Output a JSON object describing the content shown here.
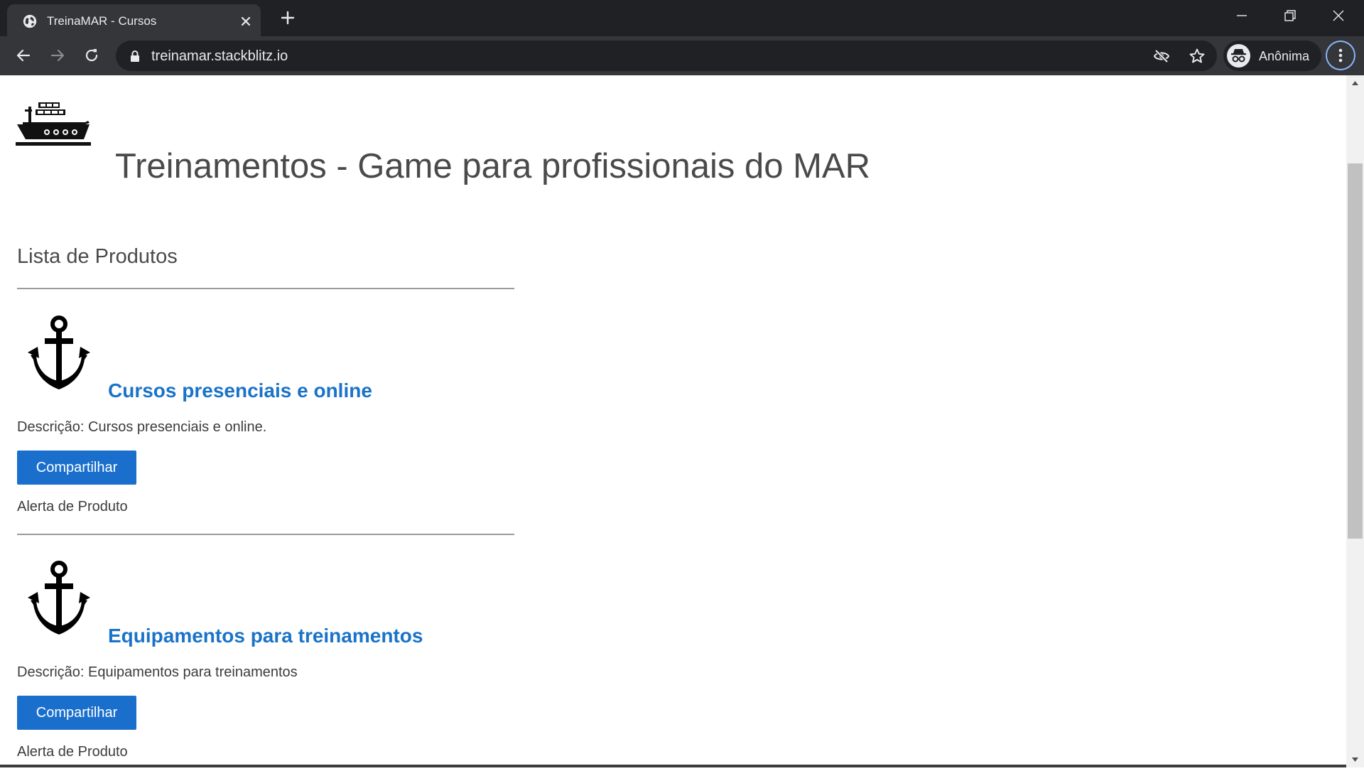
{
  "browser": {
    "tab_title": "TreinaMAR - Cursos",
    "url": "treinamar.stackblitz.io",
    "profile_label": "Anônima",
    "chrome_color": "#202124",
    "toolbar_color": "#35363a"
  },
  "page": {
    "title": "Treinamentos - Game para profissionais do MAR",
    "list_heading": "Lista de Produtos",
    "accent_color": "#1a73c8",
    "products": [
      {
        "name": "Cursos presenciais e online",
        "description": "Descrição: Cursos presenciais e online.",
        "share_label": "Compartilhar",
        "alert": "Alerta de Produto",
        "icon": "anchor-icon"
      },
      {
        "name": "Equipamentos para treinamentos",
        "description": "Descrição: Equipamentos para treinamentos",
        "share_label": "Compartilhar",
        "alert": "Alerta de Produto",
        "icon": "anchor-icon"
      }
    ]
  },
  "icons": {
    "logo": "ship-icon",
    "favicon": "globe-icon"
  }
}
